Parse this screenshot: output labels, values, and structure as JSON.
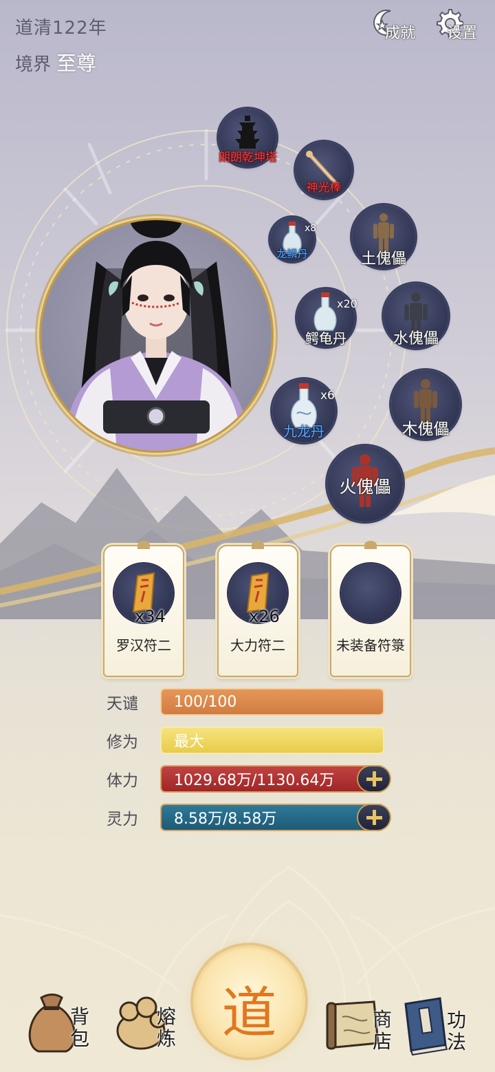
{
  "header": {
    "era": "道清122年",
    "realm_label": "境界",
    "realm_value": "至尊",
    "achievements_label": "成就",
    "settings_label": "设置"
  },
  "equipment": [
    {
      "name": "朗朗乾坤塔",
      "style": "red"
    },
    {
      "name": "神光棒",
      "style": "red"
    },
    {
      "name": "龙鳞丹",
      "count": "x8",
      "style": "blue"
    },
    {
      "name": "土傀儡",
      "style": "white"
    },
    {
      "name": "鳄龟丹",
      "count": "x20",
      "style": "white"
    },
    {
      "name": "水傀儡",
      "style": "white"
    },
    {
      "name": "九龙丹",
      "count": "x6",
      "style": "blue"
    },
    {
      "name": "木傀儡",
      "style": "white"
    },
    {
      "name": "火傀儡",
      "style": "white"
    }
  ],
  "talismans": [
    {
      "name": "罗汉符二",
      "count": "x34"
    },
    {
      "name": "大力符二",
      "count": "x26"
    },
    {
      "name": "未装备符箓",
      "count": ""
    }
  ],
  "stats": [
    {
      "label": "天谴",
      "value": "100/100",
      "color": "#d88449",
      "fill": 1.0
    },
    {
      "label": "修为",
      "value": "最大",
      "color": "#ecd35c",
      "fill": 1.0
    },
    {
      "label": "体力",
      "value": "1029.68万/1130.64万",
      "color": "#ad3031",
      "fill": 0.911
    },
    {
      "label": "灵力",
      "value": "8.58万/8.58万",
      "color": "#246582",
      "fill": 1.0
    }
  ],
  "nav": {
    "bag": "背包",
    "refine": "熔炼",
    "dao": "道",
    "shop": "商店",
    "skills": "功法"
  }
}
